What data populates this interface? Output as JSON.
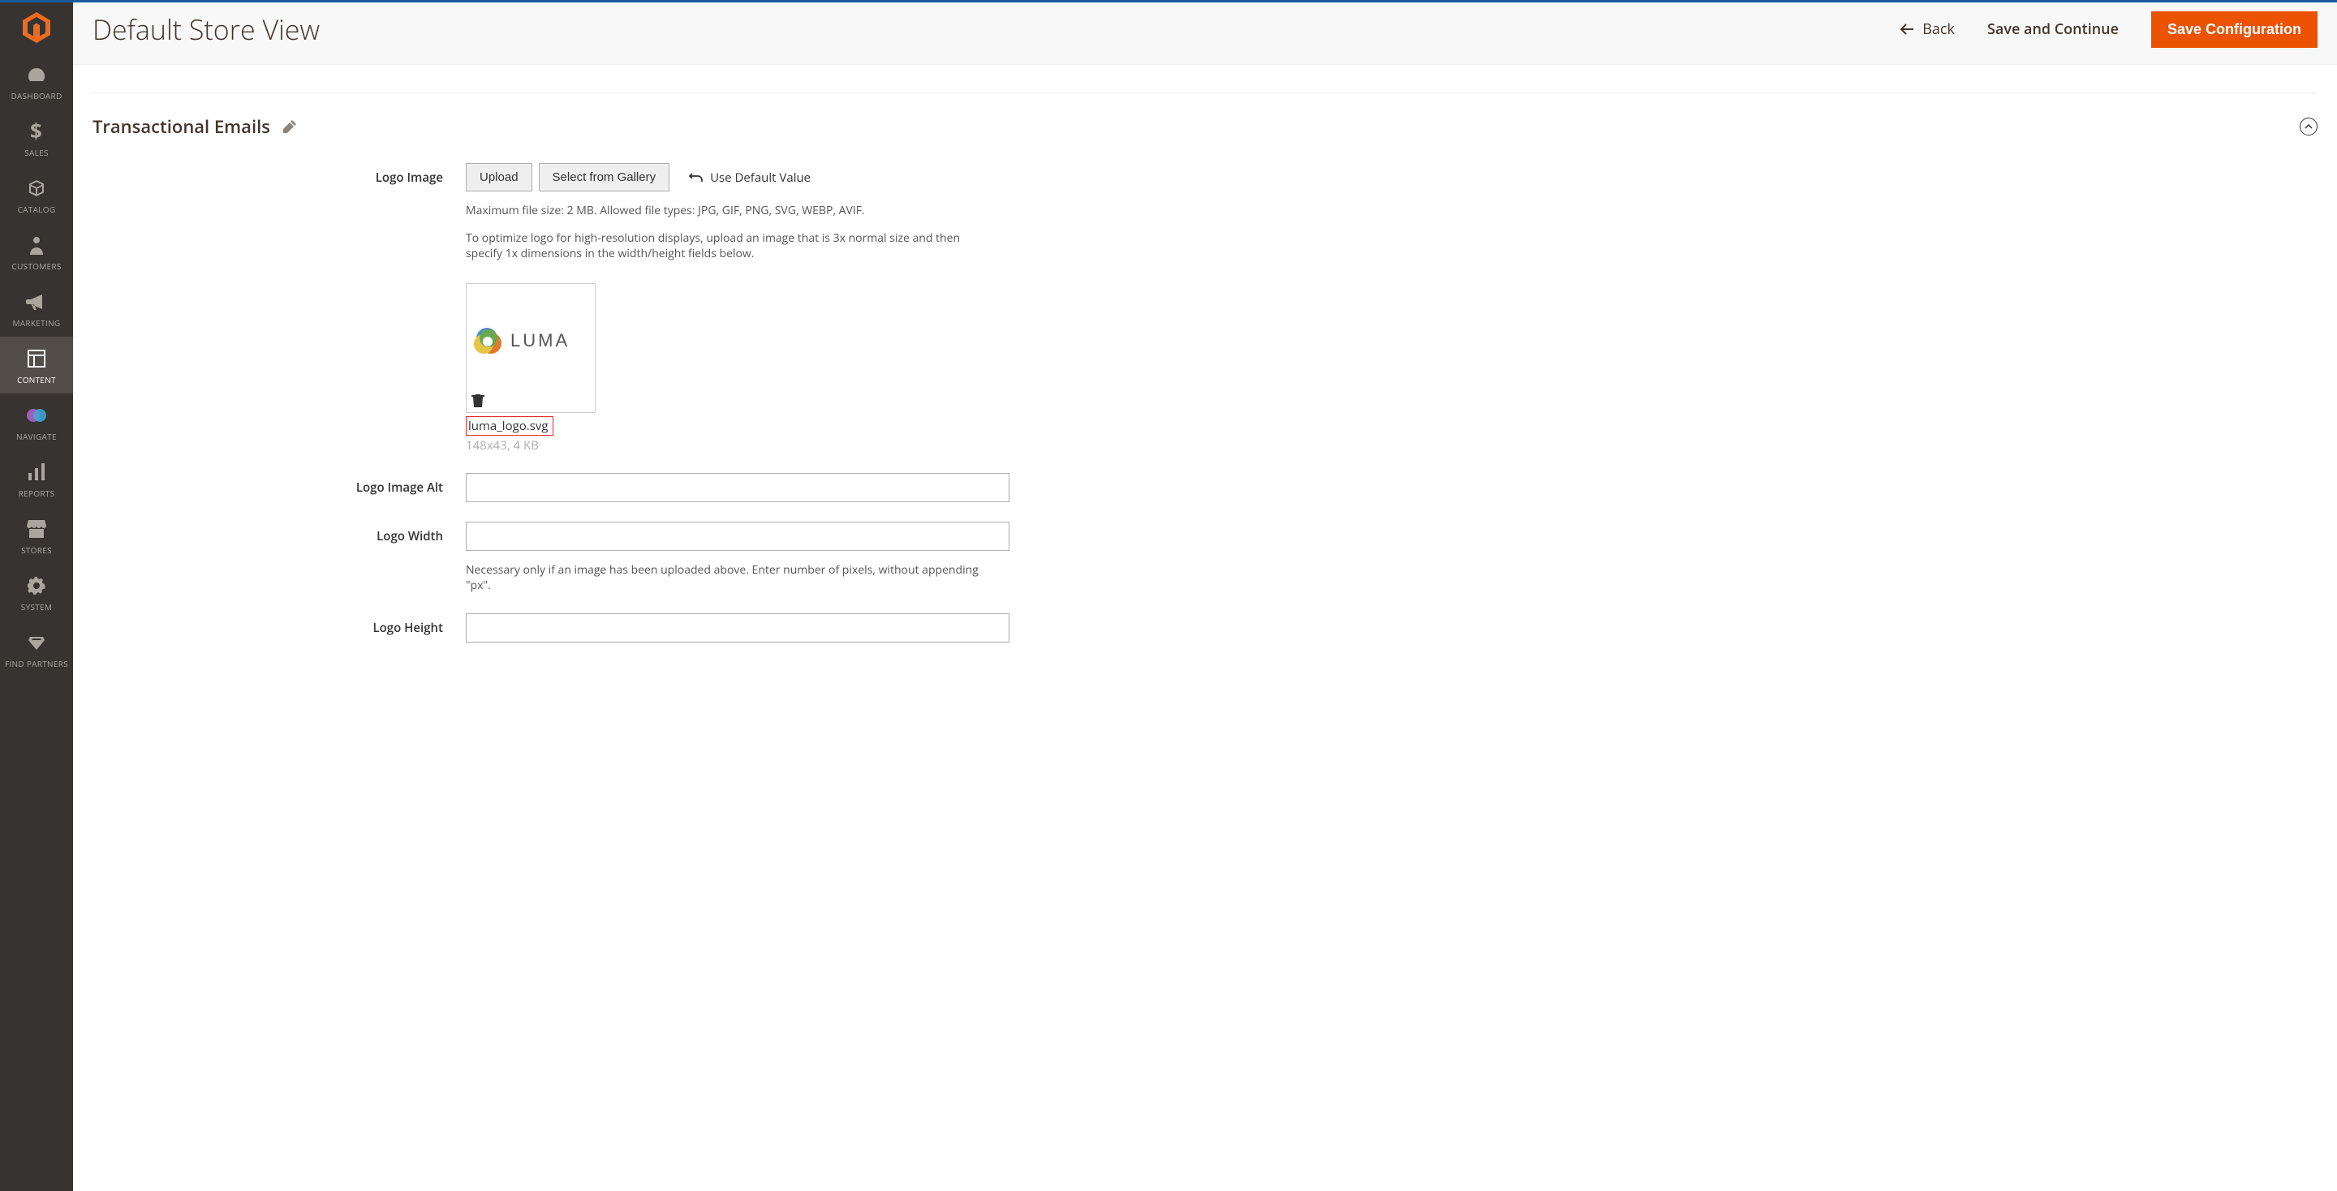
{
  "sidebar": {
    "items": [
      {
        "label": "DASHBOARD"
      },
      {
        "label": "SALES"
      },
      {
        "label": "CATALOG"
      },
      {
        "label": "CUSTOMERS"
      },
      {
        "label": "MARKETING"
      },
      {
        "label": "CONTENT"
      },
      {
        "label": "NAVIGATE"
      },
      {
        "label": "REPORTS"
      },
      {
        "label": "STORES"
      },
      {
        "label": "SYSTEM"
      },
      {
        "label": "FIND PARTNERS"
      }
    ]
  },
  "header": {
    "title": "Default Store View",
    "back_label": "Back",
    "save_continue_label": "Save and Continue",
    "save_config_label": "Save Configuration"
  },
  "section": {
    "title": "Transactional Emails"
  },
  "logo_image": {
    "label": "Logo Image",
    "upload_label": "Upload",
    "gallery_label": "Select from Gallery",
    "use_default_label": "Use Default Value",
    "help1": "Maximum file size: 2 MB. Allowed file types: JPG, GIF, PNG, SVG, WEBP, AVIF.",
    "help2": "To optimize logo for high-resolution displays, upload an image that is 3x normal size and then specify 1x dimensions in the width/height fields below.",
    "filename": "luma_logo.svg",
    "meta": "148x43, 4 KB",
    "preview_text": "LUMA"
  },
  "logo_alt": {
    "label": "Logo Image Alt",
    "value": ""
  },
  "logo_width": {
    "label": "Logo Width",
    "value": "",
    "help": "Necessary only if an image has been uploaded above. Enter number of pixels, without appending \"px\"."
  },
  "logo_height": {
    "label": "Logo Height",
    "value": ""
  }
}
